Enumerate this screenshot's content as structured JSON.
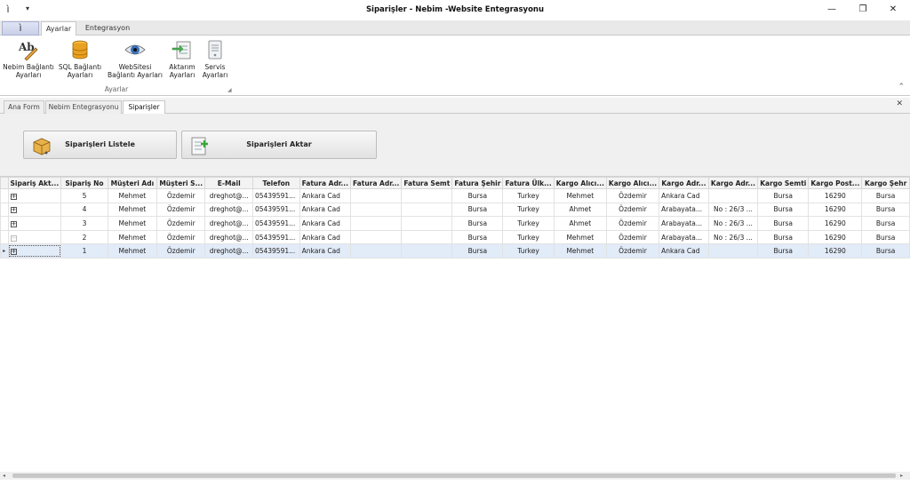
{
  "window": {
    "title": "Siparişler - Nebim -Website Entegrasyonu",
    "qat_icon": "ì",
    "qat_arrow": "▾",
    "minimize": "—",
    "restore": "❐",
    "close": "✕"
  },
  "ribbon": {
    "tabs": [
      "Ayarlar",
      "Entegrasyon"
    ],
    "active_tab": "Ayarlar",
    "buttons": [
      {
        "label1": "Nebim Bağlantı",
        "label2": "Ayarları",
        "icon": "ab-pencil-icon"
      },
      {
        "label1": "SQL Bağlantı",
        "label2": "Ayarları",
        "icon": "database-icon"
      },
      {
        "label1": "WebSitesi",
        "label2": "Bağlantı Ayarları",
        "icon": "eye-icon"
      },
      {
        "label1": "Aktarım",
        "label2": "Ayarları",
        "icon": "transfer-icon"
      },
      {
        "label1": "Servis",
        "label2": "Ayarları",
        "icon": "server-icon"
      }
    ],
    "group_label": "Ayarlar",
    "group_launcher": "◢",
    "collapse": "⌃"
  },
  "doc_tabs": {
    "tabs": [
      "Ana Form",
      "Nebim Entegrasyonu",
      "Siparişler"
    ],
    "active": "Siparişler",
    "close": "✕"
  },
  "actions": {
    "list_label": "Siparişleri Listele",
    "transfer_label": "Siparişleri Aktar"
  },
  "grid": {
    "columns": [
      "Sipariş Akt...",
      "Sipariş No",
      "Müşteri Adı",
      "Müşteri S...",
      "E-Mail",
      "Telefon",
      "Fatura Adr...",
      "Fatura Adr...",
      "Fatura Semt",
      "Fatura Şehir",
      "Fatura Ülk...",
      "Kargo Alıcı...",
      "Kargo Alıcı...",
      "Kargo Adr...",
      "Kargo Adr...",
      "Kargo Semti",
      "Kargo Post...",
      "Kargo Şehr"
    ],
    "rows": [
      {
        "expander": "⊞",
        "cells": [
          "5",
          "Mehmet",
          "Özdemir",
          "dreghot@...",
          "05439591...",
          "Ankara  Cad",
          "",
          "",
          "Bursa",
          "Turkey",
          "Mehmet",
          "Özdemir",
          "Ankara  Cad",
          "",
          "Bursa",
          "16290",
          "Bursa"
        ]
      },
      {
        "expander": "⊞",
        "cells": [
          "4",
          "Mehmet",
          "Özdemir",
          "dreghot@...",
          "05439591...",
          "Ankara  Cad",
          "",
          "",
          "Bursa",
          "Turkey",
          "Ahmet",
          "Özdemir",
          "Arabayata...",
          "No : 26/3 ...",
          "Bursa",
          "16290",
          "Bursa"
        ]
      },
      {
        "expander": "⊞",
        "cells": [
          "3",
          "Mehmet",
          "Özdemir",
          "dreghot@...",
          "05439591...",
          "Ankara  Cad",
          "",
          "",
          "Bursa",
          "Turkey",
          "Ahmet",
          "Özdemir",
          "Arabayata...",
          "No : 26/3 ...",
          "Bursa",
          "16290",
          "Bursa"
        ]
      },
      {
        "expander": "⊟",
        "cells": [
          "2",
          "Mehmet",
          "Özdemir",
          "dreghot@...",
          "05439591...",
          "Ankara  Cad",
          "",
          "",
          "Bursa",
          "Turkey",
          "Mehmet",
          "Özdemir",
          "Arabayata...",
          "No : 26/3 ...",
          "Bursa",
          "16290",
          "Bursa"
        ]
      },
      {
        "expander": "⊞",
        "cells": [
          "1",
          "Mehmet",
          "Özdemir",
          "dreghot@...",
          "05439591...",
          "Ankara  Cad",
          "",
          "",
          "Bursa",
          "Turkey",
          "Mehmet",
          "Özdemir",
          "Ankara  Cad",
          "",
          "Bursa",
          "16290",
          "Bursa"
        ]
      }
    ],
    "selected_row_index": 4,
    "row_indicator": "▸"
  },
  "colors": {
    "selected_row": "#e2ebf8",
    "panel_bg": "#f0f0f0"
  }
}
